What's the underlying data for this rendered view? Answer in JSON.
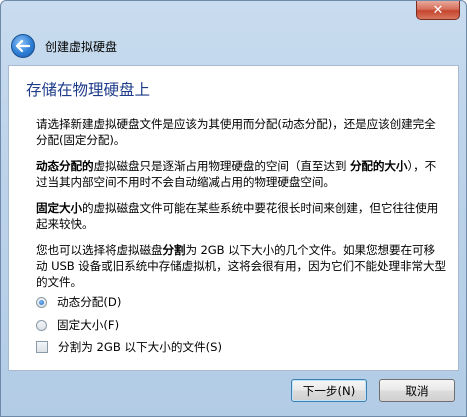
{
  "window": {
    "close_label": "✕",
    "nav_title": "创建虚拟硬盘"
  },
  "page": {
    "heading": "存储在物理硬盘上",
    "p1": "请选择新建虚拟硬盘文件是应该为其使用而分配(动态分配)，还是应该创建完全分配(固定分配)。",
    "p2_bold1": "动态分配的",
    "p2_text1": "虚拟磁盘只是逐渐占用物理硬盘的空间（直至达到 ",
    "p2_bold2": "分配的大小",
    "p2_text2": "），不过当其内部空间不用时不会自动缩减占用的物理硬盘空间。",
    "p3_bold": "固定大小",
    "p3_text": "的虚拟磁盘文件可能在某些系统中要花很长时间来创建，但它往往使用起来较快。",
    "p4_text1": "您也可以选择将虚拟磁盘",
    "p4_bold": "分割",
    "p4_text2": "为 2GB 以下大小的几个文件。如果您想要在可移动 USB 设备或旧系统中存储虚拟机，这将会很有用，因为它们不能处理非常大型的文件。"
  },
  "options": {
    "dynamic_label": "动态分配(D)",
    "fixed_label": "固定大小(F)",
    "split_label": "分割为 2GB 以下大小的文件(S)",
    "selected": "dynamic",
    "split_checked": false
  },
  "buttons": {
    "next_label": "下一步(N)",
    "cancel_label": "取消"
  }
}
